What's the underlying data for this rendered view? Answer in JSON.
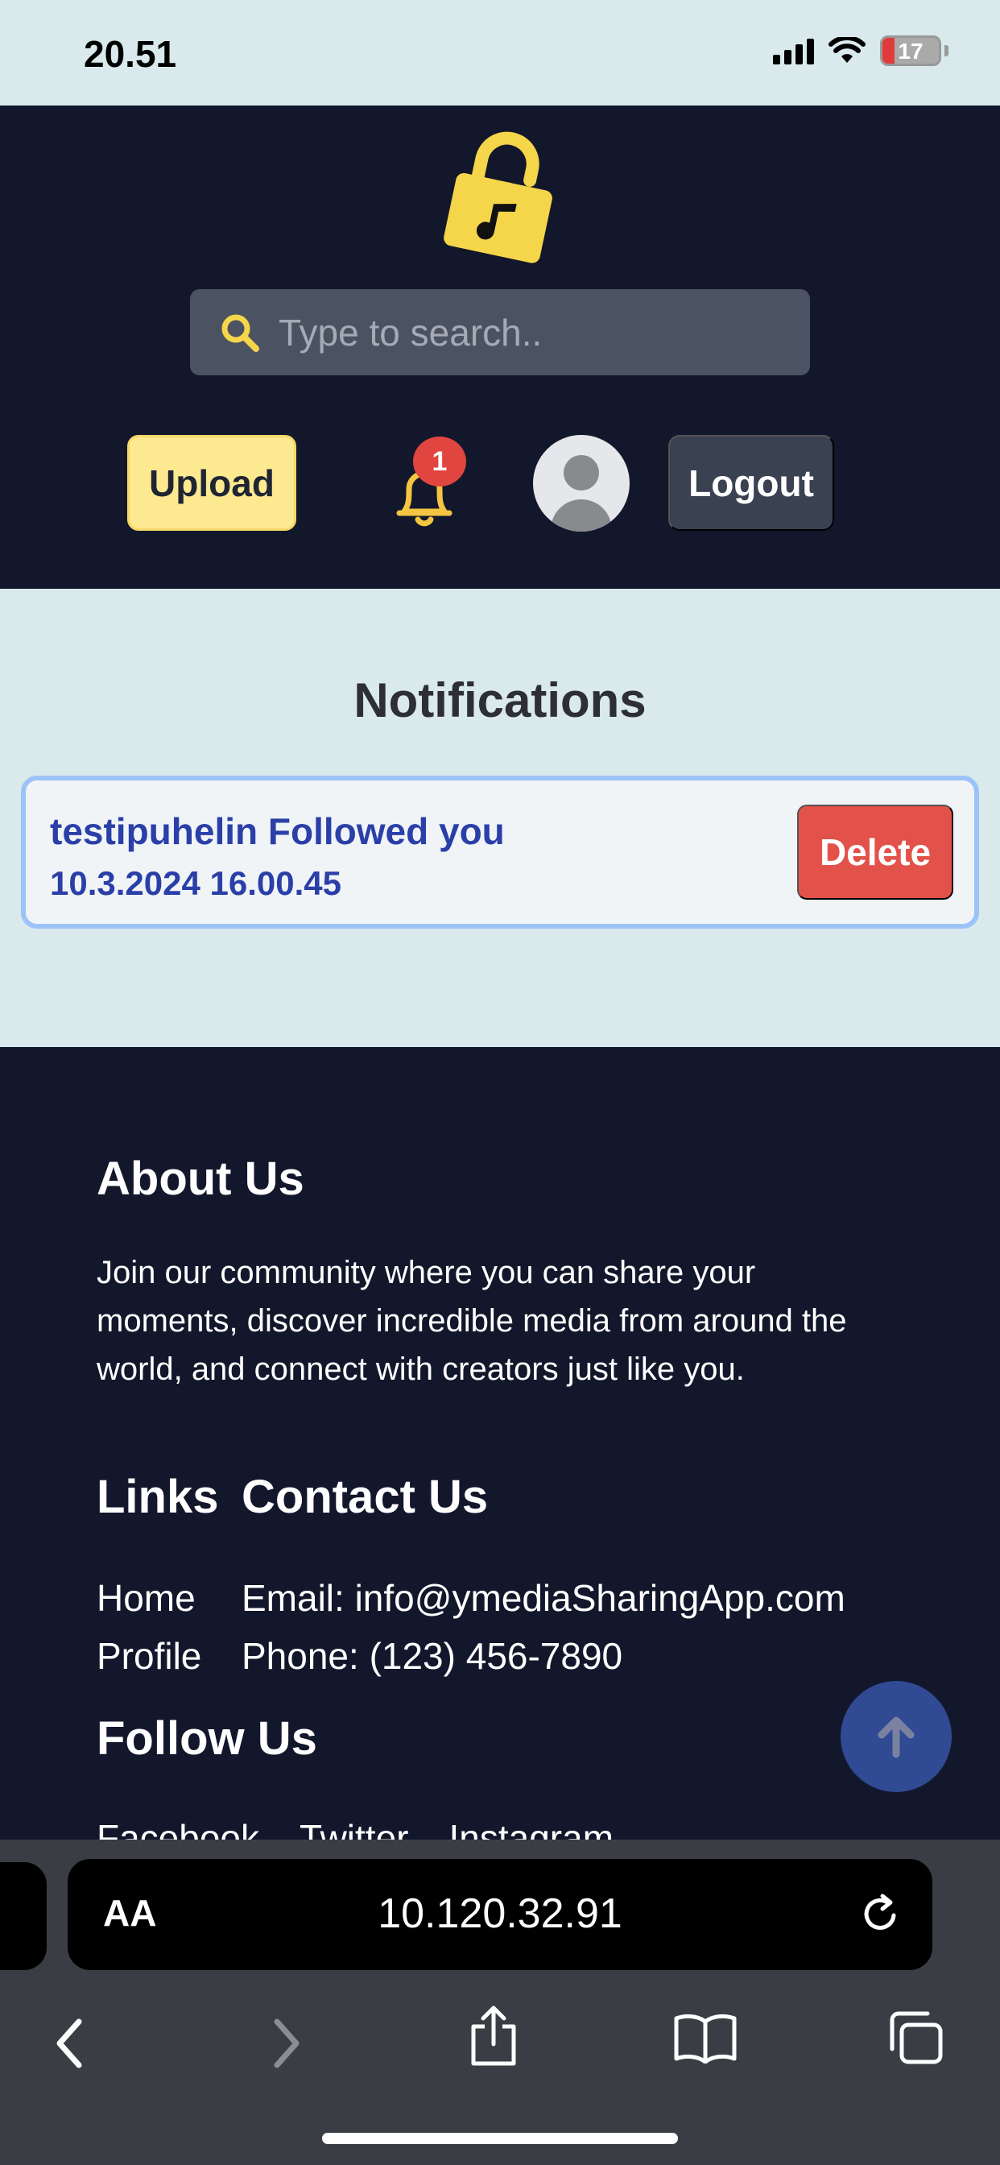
{
  "status_bar": {
    "time": "20.51",
    "battery": "17"
  },
  "header": {
    "search_placeholder": "Type to search..",
    "upload_label": "Upload",
    "notification_count": "1",
    "logout_label": "Logout"
  },
  "main": {
    "title": "Notifications",
    "notifications": [
      {
        "text": "testipuhelin Followed you",
        "date": "10.3.2024 16.00.45",
        "delete_label": "Delete"
      }
    ]
  },
  "footer": {
    "about_title": "About Us",
    "about_text": "Join our community where you can share your moments, discover incredible media from around the world, and connect with creators just like you.",
    "links_title": "Links",
    "contact_title": "Contact Us",
    "links": [
      "Home",
      "Profile"
    ],
    "contact": [
      "Email: info@ymediaSharingApp.com",
      "Phone: (123) 456-7890"
    ],
    "follow_title": "Follow Us",
    "social": [
      "Facebook",
      "Twitter",
      "Instagram"
    ]
  },
  "browser": {
    "aa_label": "AA",
    "url": "10.120.32.91"
  },
  "colors": {
    "header_bg": "#13172b",
    "page_bg": "#d9e9ec",
    "accent_yellow": "#fde98f",
    "delete_red": "#e3524a",
    "notif_text": "#2a3fa8"
  },
  "icons": [
    "search-icon",
    "bell-icon",
    "lock-music-logo",
    "avatar-icon",
    "arrow-up-icon",
    "reload-icon",
    "back-icon",
    "forward-icon",
    "share-icon",
    "bookmarks-icon",
    "tabs-icon"
  ]
}
